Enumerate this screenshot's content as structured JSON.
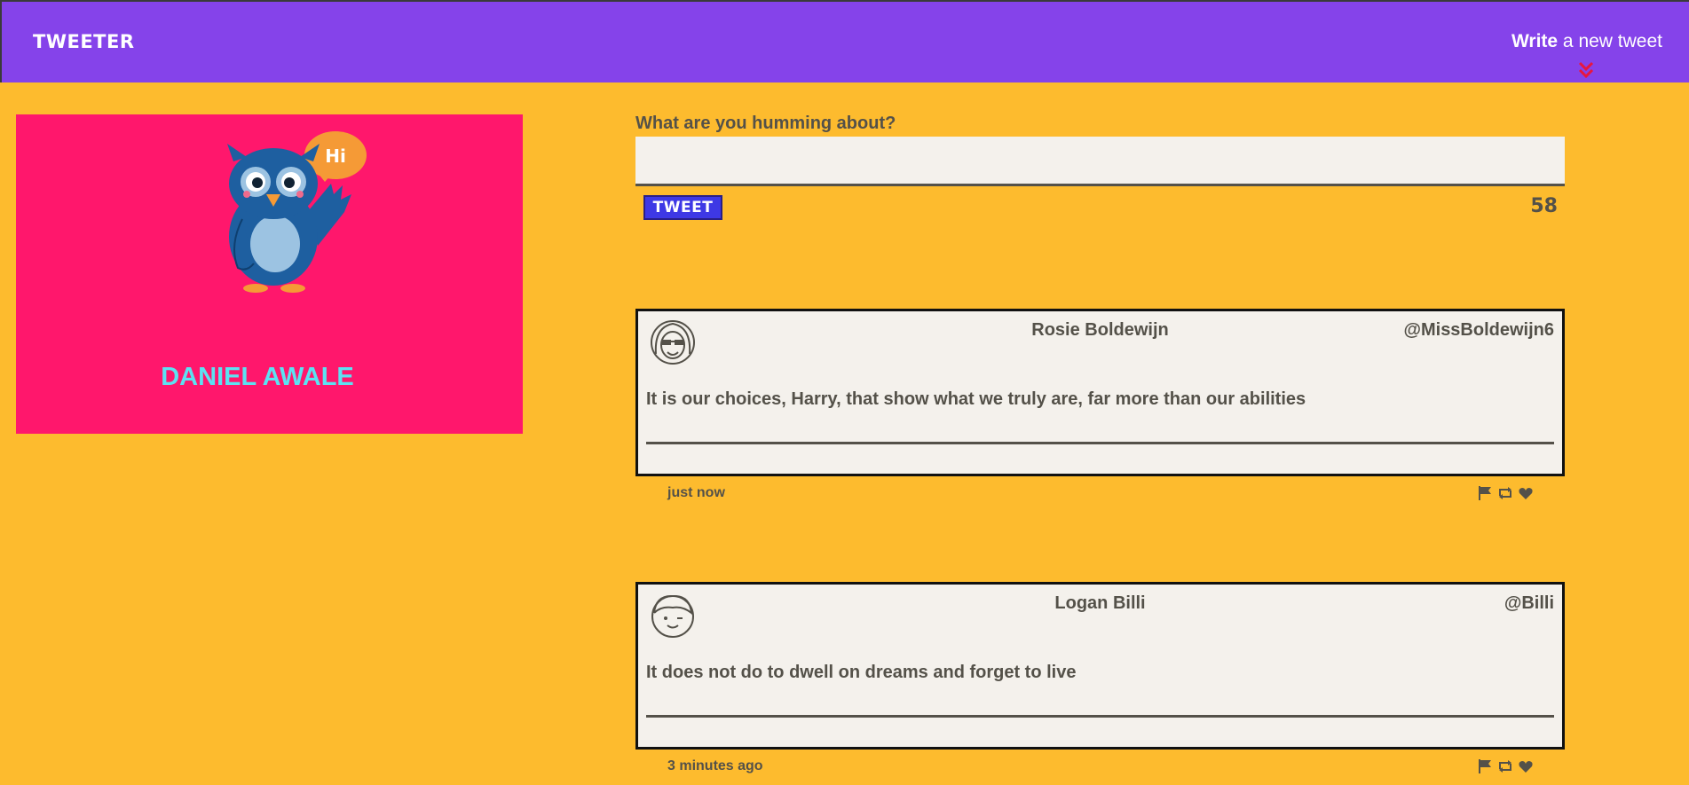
{
  "nav": {
    "brand": "TWEETER",
    "compose_bold": "Write",
    "compose_rest": " a new tweet"
  },
  "profile": {
    "name": "DANIEL AWALE",
    "speech_bubble": "Hi"
  },
  "compose": {
    "label": "What are you humming about?",
    "placeholder": "",
    "submit_label": "TWEET",
    "char_count": "58"
  },
  "tweets": [
    {
      "name": "Rosie Boldewijn",
      "handle": "@MissBoldewijn6",
      "content": "It is our choices, Harry, that show what we truly are, far more than our abilities",
      "time": "just now"
    },
    {
      "name": "Logan Billi",
      "handle": "@Billi",
      "content": "It does not do to dwell on dreams and forget to live",
      "time": "3 minutes ago"
    }
  ],
  "colors": {
    "background": "#FDBB2E",
    "navbar": "#8543EA",
    "profile_card": "#FF176C",
    "profile_name": "#5CE2F2",
    "tweet_button": "#3E38E5",
    "chevron": "#E8163E"
  },
  "icons": [
    "chevron-double-down-icon",
    "flag-icon",
    "retweet-icon",
    "heart-icon",
    "owl-mascot",
    "avatar-woman-glasses-icon",
    "avatar-man-wink-icon"
  ]
}
